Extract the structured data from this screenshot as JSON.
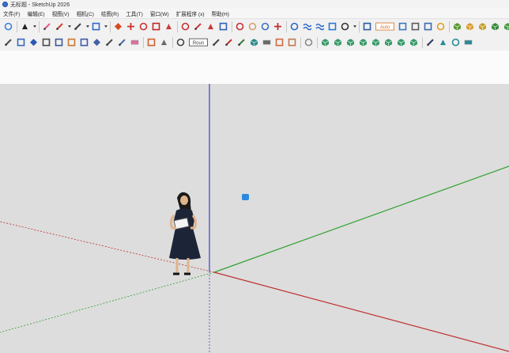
{
  "window": {
    "title": "无标题 - SketchUp 2026"
  },
  "menu": [
    "文件(F)",
    "编辑(E)",
    "视图(V)",
    "相机(C)",
    "绘图(R)",
    "工具(T)",
    "窗口(W)",
    "扩展程序 (x)",
    "帮助(H)"
  ],
  "toolbar1": [
    {
      "id": "zoom-extents",
      "icon": "magnifier-icon",
      "color": "#3c7fd8",
      "shape": "round"
    },
    {
      "sep": true
    },
    {
      "id": "select",
      "icon": "arrow-cursor-icon",
      "color": "#222222",
      "shape": "tri",
      "dd": true
    },
    {
      "sep": true
    },
    {
      "id": "eraser",
      "icon": "eraser-icon",
      "color": "#e05a8a",
      "shape": "diag"
    },
    {
      "id": "line",
      "icon": "pencil-icon",
      "color": "#d04030",
      "shape": "diag",
      "dd": true
    },
    {
      "id": "freehand",
      "icon": "curve-icon",
      "color": "#404040",
      "shape": "diag",
      "dd": true
    },
    {
      "id": "rectangle",
      "icon": "rectangle-icon",
      "color": "#3068c8",
      "shape": "square",
      "dd": true
    },
    {
      "sep": true
    },
    {
      "id": "push-pull",
      "icon": "push-pull-icon",
      "color": "#d84a20",
      "shape": "diamond"
    },
    {
      "id": "move",
      "icon": "move-icon",
      "color": "#d03030",
      "shape": "cross"
    },
    {
      "id": "rotate",
      "icon": "rotate-icon",
      "color": "#d03030",
      "shape": "round"
    },
    {
      "id": "scale",
      "icon": "scale-icon",
      "color": "#c02828",
      "shape": "square"
    },
    {
      "id": "offset",
      "icon": "offset-icon",
      "color": "#c84040",
      "shape": "tri"
    },
    {
      "sep": true
    },
    {
      "id": "tape",
      "icon": "tape-measure-icon",
      "color": "#c83030",
      "shape": "round"
    },
    {
      "id": "dimension",
      "icon": "dimension-icon",
      "color": "#cc3a3a",
      "shape": "diag"
    },
    {
      "id": "protractor",
      "icon": "protractor-icon",
      "color": "#c83a3a",
      "shape": "tri"
    },
    {
      "id": "text",
      "icon": "text-icon",
      "color": "#3060b8",
      "shape": "square"
    },
    {
      "sep": true
    },
    {
      "id": "orbit",
      "icon": "orbit-icon",
      "color": "#c83030",
      "shape": "round"
    },
    {
      "id": "pan",
      "icon": "hand-pan-icon",
      "color": "#d8a070",
      "shape": "round"
    },
    {
      "id": "zoom",
      "icon": "zoom-icon",
      "color": "#4070c0",
      "shape": "round"
    },
    {
      "id": "zoom-window",
      "icon": "zoom-window-icon",
      "color": "#c03030",
      "shape": "cross"
    },
    {
      "sep": true
    },
    {
      "id": "sandbox-1",
      "icon": "sandbox-contour-icon",
      "color": "#2a6ac8",
      "shape": "round"
    },
    {
      "id": "sandbox-2",
      "icon": "sandbox-mesh-icon",
      "color": "#2a6ac8",
      "shape": "wave"
    },
    {
      "id": "sandbox-3",
      "icon": "sandbox-smoove-icon",
      "color": "#2a6ac8",
      "shape": "wave"
    },
    {
      "id": "sandbox-4",
      "icon": "sandbox-stamp-icon",
      "color": "#2a78d0",
      "shape": "square"
    },
    {
      "id": "account",
      "icon": "account-icon",
      "color": "#333333",
      "shape": "round",
      "dd": true
    },
    {
      "sep": true
    },
    {
      "id": "style-1",
      "icon": "style-frame-icon",
      "color": "#2a5aa0",
      "shape": "square"
    },
    {
      "id": "auto",
      "icon": "auto-icon",
      "color": "#d87020",
      "shape": "label",
      "label": "Auto",
      "wide": true
    },
    {
      "id": "dyn-1",
      "icon": "dynamic-component-icon",
      "color": "#3a78c0",
      "shape": "square"
    },
    {
      "id": "dyn-2",
      "icon": "dynamic-options-icon",
      "color": "#5a5a5a",
      "shape": "square"
    },
    {
      "id": "dyn-3",
      "icon": "dynamic-attributes-icon",
      "color": "#3a6ab0",
      "shape": "square"
    },
    {
      "id": "gear",
      "icon": "gear-icon",
      "color": "#e0a020",
      "shape": "round"
    },
    {
      "sep": true
    },
    {
      "id": "ext-1",
      "icon": "cube-green-icon",
      "color": "#5a9a30",
      "shape": "cube"
    },
    {
      "id": "ext-2",
      "icon": "cube-orange-icon",
      "color": "#d8a030",
      "shape": "cube"
    },
    {
      "id": "ext-3",
      "icon": "cube-yellow-icon",
      "color": "#c8a030",
      "shape": "cube"
    },
    {
      "id": "ext-4",
      "icon": "shield-green-icon",
      "color": "#3a8a40",
      "shape": "cube"
    },
    {
      "id": "ext-5",
      "icon": "cube-blocks-icon",
      "color": "#4a9a40",
      "shape": "cube"
    },
    {
      "id": "ext-6",
      "icon": "bucket-icon",
      "color": "#7a9a40",
      "shape": "cube"
    },
    {
      "sep": true
    },
    {
      "id": "ext-7",
      "icon": "flat-pad-icon",
      "color": "#d8d8d8",
      "shape": "flat"
    }
  ],
  "toolbar2": [
    {
      "id": "t2-1",
      "icon": "knife-icon",
      "color": "#4a4a4a",
      "shape": "diag"
    },
    {
      "id": "t2-2",
      "icon": "follow-me-icon",
      "color": "#3a6ab8",
      "shape": "square"
    },
    {
      "id": "t2-3",
      "icon": "blue-shape-icon",
      "color": "#2a5ab0",
      "shape": "diamond"
    },
    {
      "id": "t2-4",
      "icon": "stairs-icon",
      "color": "#4a4a4a",
      "shape": "square"
    },
    {
      "id": "t2-5",
      "icon": "box-frame-icon",
      "color": "#3a5a98",
      "shape": "square"
    },
    {
      "id": "t2-6",
      "icon": "box-open-icon",
      "color": "#c87a30",
      "shape": "square"
    },
    {
      "id": "t2-7",
      "icon": "box-stack-icon",
      "color": "#3a5aa8",
      "shape": "square"
    },
    {
      "id": "t2-8",
      "icon": "folded-box-icon",
      "color": "#4060a8",
      "shape": "diamond"
    },
    {
      "id": "t2-9",
      "icon": "bow-icon",
      "color": "#4a4a4a",
      "shape": "diag"
    },
    {
      "id": "t2-10",
      "icon": "split-icon",
      "color": "#4a6aa8",
      "shape": "diag"
    },
    {
      "id": "t2-11",
      "icon": "pink-slab-icon",
      "color": "#e070a0",
      "shape": "flat"
    },
    {
      "sep": true
    },
    {
      "id": "t2-12",
      "icon": "panel-icon",
      "color": "#d06030",
      "shape": "square"
    },
    {
      "id": "t2-13",
      "icon": "hook-icon",
      "color": "#6a6a6a",
      "shape": "tri"
    },
    {
      "sep": true
    },
    {
      "id": "t2-14",
      "icon": "loop-icon",
      "color": "#444444",
      "shape": "round"
    },
    {
      "id": "t2-15",
      "icon": "label-pill-icon",
      "color": "#444444",
      "shape": "label",
      "label": "Roun",
      "wide": true
    },
    {
      "id": "t2-16",
      "icon": "shape-pen-icon",
      "color": "#444444",
      "shape": "diag"
    },
    {
      "id": "t2-17",
      "icon": "line-slash-icon",
      "color": "#c03030",
      "shape": "diag"
    },
    {
      "id": "t2-18",
      "icon": "extrude-line-icon",
      "color": "#3a7a40",
      "shape": "diag"
    },
    {
      "id": "t2-19",
      "icon": "cube-teal-icon",
      "color": "#2a8a8a",
      "shape": "cube"
    },
    {
      "id": "t2-20",
      "icon": "ruler-icon",
      "color": "#6a6a6a",
      "shape": "flat"
    },
    {
      "id": "t2-21",
      "icon": "grid-fill-icon",
      "color": "#d06a40",
      "shape": "square"
    },
    {
      "id": "t2-22",
      "icon": "grid-outline-icon",
      "color": "#c07a50",
      "shape": "square"
    },
    {
      "sep": true
    },
    {
      "id": "t2-23",
      "icon": "pipe-bend-icon",
      "color": "#8a8a8a",
      "shape": "round"
    },
    {
      "sep": true
    },
    {
      "id": "t2-24",
      "icon": "green-cube-a-icon",
      "color": "#3a9a6a",
      "shape": "cube"
    },
    {
      "id": "t2-25",
      "icon": "green-cube-b-icon",
      "color": "#3a9a6a",
      "shape": "cube"
    },
    {
      "id": "t2-26",
      "icon": "green-cube-c-icon",
      "color": "#3a9a6a",
      "shape": "cube"
    },
    {
      "id": "t2-27",
      "icon": "green-cube-d-icon",
      "color": "#3a9a6a",
      "shape": "cube"
    },
    {
      "id": "t2-28",
      "icon": "green-cube-e-icon",
      "color": "#3a9a6a",
      "shape": "cube"
    },
    {
      "id": "t2-29",
      "icon": "green-cube-f-icon",
      "color": "#3a9a6a",
      "shape": "cube"
    },
    {
      "id": "t2-30",
      "icon": "green-cube-g-icon",
      "color": "#3a9a6a",
      "shape": "cube"
    },
    {
      "id": "t2-31",
      "icon": "green-cube-h-icon",
      "color": "#3a9a6a",
      "shape": "cube"
    },
    {
      "sep": true
    },
    {
      "id": "t2-32",
      "icon": "eyedropper-icon",
      "color": "#2a3a6a",
      "shape": "diag"
    },
    {
      "id": "t2-33",
      "icon": "teal-prism-icon",
      "color": "#2a8a9a",
      "shape": "tri"
    },
    {
      "id": "t2-34",
      "icon": "teal-sphere-icon",
      "color": "#2a8a9a",
      "shape": "round"
    },
    {
      "id": "t2-35",
      "icon": "teal-panel-icon",
      "color": "#2a8a9a",
      "shape": "flat"
    }
  ],
  "scene": {
    "axis_colors": {
      "blue": "#4040cc",
      "green": "#30a030",
      "red": "#c03030"
    },
    "figure": {
      "hair": "#1a1a1a",
      "dress": "#1c2438",
      "skin": "#e0b48a",
      "book": "#f4f4f4"
    },
    "marker_color": "#2a8ae0"
  }
}
